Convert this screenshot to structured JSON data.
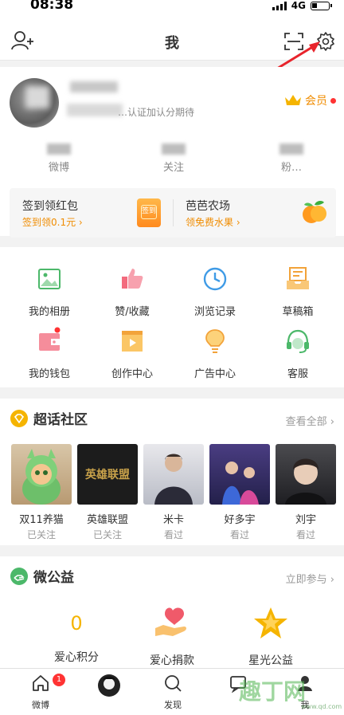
{
  "status_bar": {
    "time": "08:38",
    "network": "4G"
  },
  "header": {
    "title": "我"
  },
  "profile": {
    "description": "…认证加认分期待",
    "vip_label": "会员",
    "stats": [
      {
        "label": "微博"
      },
      {
        "label": "关注"
      },
      {
        "label": "粉…"
      }
    ],
    "promo": [
      {
        "title": "签到领红包",
        "subtitle": "签到领0.1元 ›",
        "icon": "hongbao-icon",
        "icon_text": "签到"
      },
      {
        "title": "芭芭农场",
        "subtitle": "领免费水果 ›",
        "icon": "fruit-icon"
      }
    ]
  },
  "functions": [
    {
      "label": "我的相册",
      "icon": "photo-icon"
    },
    {
      "label": "赞/收藏",
      "icon": "thumb-up-icon"
    },
    {
      "label": "浏览记录",
      "icon": "clock-icon"
    },
    {
      "label": "草稿箱",
      "icon": "draft-icon"
    },
    {
      "label": "我的钱包",
      "icon": "wallet-icon"
    },
    {
      "label": "创作中心",
      "icon": "video-icon"
    },
    {
      "label": "广告中心",
      "icon": "bulb-icon"
    },
    {
      "label": "客服",
      "icon": "headset-icon"
    }
  ],
  "super_topics": {
    "title": "超话社区",
    "more": "查看全部 ›",
    "items": [
      {
        "name": "双11养猫",
        "status": "已关注"
      },
      {
        "name": "英雄联盟",
        "status": "已关注",
        "logo_text": "英雄联盟"
      },
      {
        "name": "米卡",
        "status": "看过"
      },
      {
        "name": "好多宇",
        "status": "看过"
      },
      {
        "name": "刘宇",
        "status": "看过"
      }
    ]
  },
  "charity": {
    "title": "微公益",
    "more": "立即参与 ›",
    "items": [
      {
        "label": "爱心积分",
        "value": "0"
      },
      {
        "label": "爱心捐款",
        "icon": "donate-icon"
      },
      {
        "label": "星光公益",
        "icon": "star-icon"
      }
    ]
  },
  "tabbar": [
    {
      "label": "微博",
      "badge": "1",
      "icon": "home-icon"
    },
    {
      "label": "",
      "icon": "avatar-icon"
    },
    {
      "label": "发现",
      "icon": "search-icon"
    },
    {
      "label": "",
      "icon": "message-icon"
    },
    {
      "label": "我",
      "icon": "profile-icon"
    }
  ],
  "watermark": {
    "text": "趣丁网",
    "url": "www.qd.com"
  }
}
